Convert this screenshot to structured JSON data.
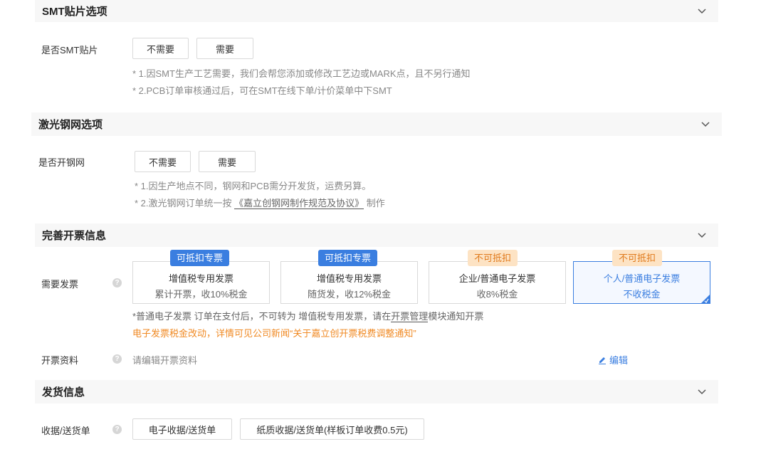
{
  "smt": {
    "title": "SMT贴片选项",
    "label": "是否SMT贴片",
    "opt_no": "不需要",
    "opt_yes": "需要",
    "note1": "* 1.因SMT生产工艺需要，我们会帮您添加或修改工艺边或MARK点，且不另行通知",
    "note2": "* 2.PCB订单审核通过后，可在SMT在线下单/计价菜单中下SMT"
  },
  "stencil": {
    "title": "激光钢网选项",
    "label": "是否开钢网",
    "opt_no": "不需要",
    "opt_yes": "需要",
    "note1": "* 1.因生产地点不同，钢网和PCB需分开发货，运费另算。",
    "note2_pre": "* 2.激光钢网订单统一按",
    "note2_link": "《嘉立创钢网制作规范及协议》",
    "note2_post": "制作"
  },
  "invoice": {
    "title": "完善开票信息",
    "label": "需要发票",
    "help": "?",
    "options": [
      {
        "badge": "可抵扣专票",
        "line1": "增值税专用发票",
        "line2": "累计开票，收10%税金"
      },
      {
        "badge": "可抵扣专票",
        "line1": "增值税专用发票",
        "line2": "随货发，收12%税金"
      },
      {
        "badge": "不可抵扣",
        "line1": "企业/普通电子发票",
        "line2": "收8%税金"
      },
      {
        "badge": "不可抵扣",
        "line1": "个人/普通电子发票",
        "line2": "不收税金"
      }
    ],
    "selected_index": 3,
    "note_pre": "*普通电子发票 订单在支付后，不可转为 增值税专用发票，请在",
    "note_link": "开票管理",
    "note_post": "模块通知开票",
    "warning": "电子发票税金改动，详情可见公司新闻“关于嘉立创开票税费调整通知”",
    "info_label": "开票资料",
    "info_placeholder": "请编辑开票资料",
    "edit_label": "编辑"
  },
  "shipping": {
    "title": "发货信息",
    "label": "收据/送货单",
    "opt_electronic": "电子收据/送货单",
    "opt_paper": "纸质收据/送货单(样板订单收费0.5元)"
  },
  "colors": {
    "accent": "#3a7ee0",
    "warning": "#f08a24",
    "badge_orange_bg": "#fde3c4"
  }
}
